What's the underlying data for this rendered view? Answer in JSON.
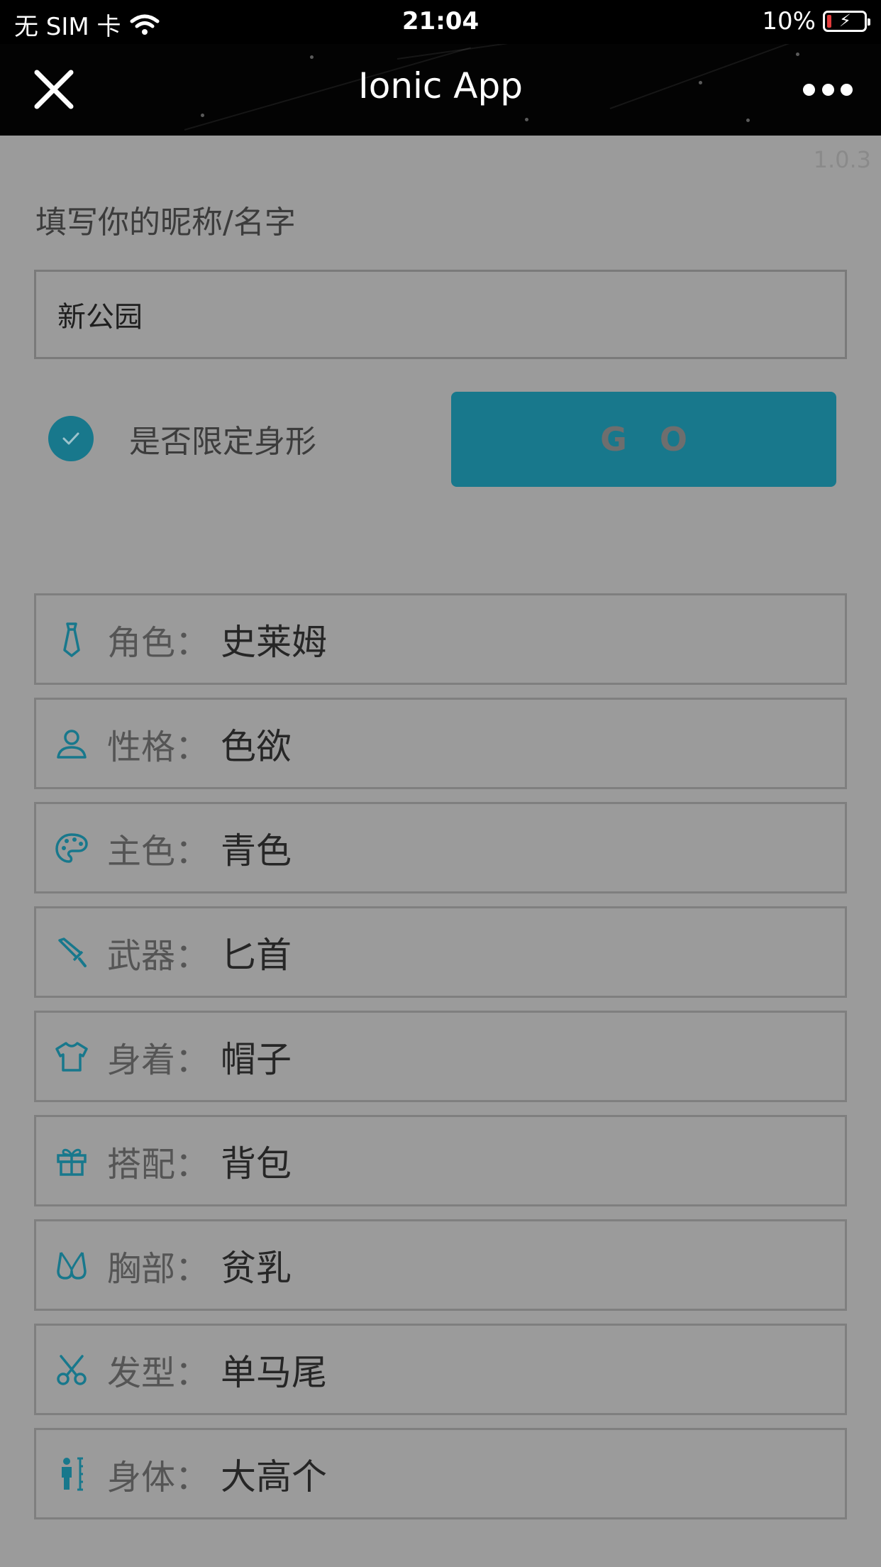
{
  "status_bar": {
    "carrier": "无 SIM 卡",
    "time": "21:04",
    "battery": "10%"
  },
  "nav": {
    "title": "Ionic App"
  },
  "version": "1.0.3",
  "form": {
    "prompt": "填写你的昵称/名字",
    "name_value": "新公园",
    "check_label": "是否限定身形",
    "check_checked": true,
    "go_label": "GO"
  },
  "colors": {
    "accent": "#18788c",
    "background": "#9b9b9b",
    "navbar": "#030303"
  },
  "attributes": [
    {
      "icon": "tie-icon",
      "label": "角色：",
      "value": "史莱姆"
    },
    {
      "icon": "person-icon",
      "label": "性格：",
      "value": "色欲"
    },
    {
      "icon": "palette-icon",
      "label": "主色：",
      "value": "青色"
    },
    {
      "icon": "dagger-icon",
      "label": "武器：",
      "value": "匕首"
    },
    {
      "icon": "shirt-icon",
      "label": "身着：",
      "value": "帽子"
    },
    {
      "icon": "gift-icon",
      "label": "搭配：",
      "value": "背包"
    },
    {
      "icon": "bra-icon",
      "label": "胸部：",
      "value": "贫乳"
    },
    {
      "icon": "scissors-icon",
      "label": "发型：",
      "value": "单马尾"
    },
    {
      "icon": "height-icon",
      "label": "身体：",
      "value": "大高个"
    }
  ]
}
